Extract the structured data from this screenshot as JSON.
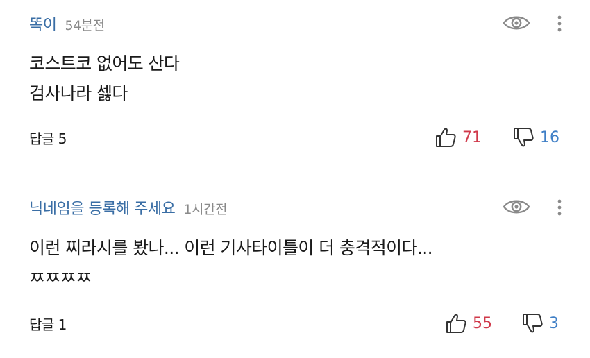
{
  "comments": [
    {
      "nickname": "똑이",
      "time": "54분전",
      "lines": [
        "코스트코 없어도 산다",
        "검사나라 셇다"
      ],
      "replies_label": "답글 5",
      "likes": "71",
      "dislikes": "16"
    },
    {
      "nickname": "닉네임을 등록해 주세요",
      "time": "1시간전",
      "lines": [
        "이런 찌라시를 봤나... 이런 기사타이틀이 더 충격적이다...",
        "ㅉㅉㅉㅉ"
      ],
      "replies_label": "답글 1",
      "likes": "55",
      "dislikes": "3"
    }
  ],
  "icons": {
    "hide": "eye-icon",
    "more": "more-vertical-icon",
    "like": "thumbs-up-icon",
    "dislike": "thumbs-down-icon"
  },
  "colors": {
    "nickname": "#3a6ea5",
    "time": "#8a8a8a",
    "like": "#d0394a",
    "dislike": "#3f7fc6"
  }
}
